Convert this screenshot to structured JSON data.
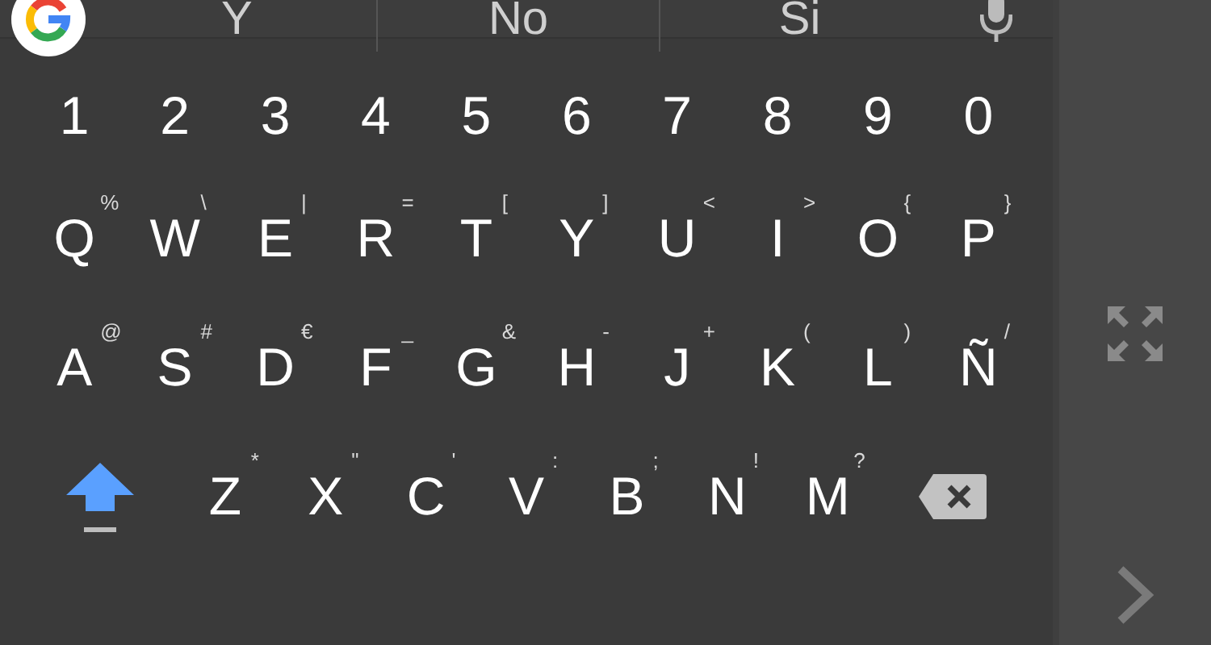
{
  "suggestions": [
    {
      "text": "Y"
    },
    {
      "text": "No"
    },
    {
      "text": "Si"
    }
  ],
  "rows": [
    [
      {
        "kind": "char",
        "label": "1"
      },
      {
        "kind": "char",
        "label": "2"
      },
      {
        "kind": "char",
        "label": "3"
      },
      {
        "kind": "char",
        "label": "4"
      },
      {
        "kind": "char",
        "label": "5"
      },
      {
        "kind": "char",
        "label": "6"
      },
      {
        "kind": "char",
        "label": "7"
      },
      {
        "kind": "char",
        "label": "8"
      },
      {
        "kind": "char",
        "label": "9"
      },
      {
        "kind": "char",
        "label": "0"
      }
    ],
    [
      {
        "kind": "char",
        "label": "Q",
        "hint": "%"
      },
      {
        "kind": "char",
        "label": "W",
        "hint": "\\"
      },
      {
        "kind": "char",
        "label": "E",
        "hint": "|"
      },
      {
        "kind": "char",
        "label": "R",
        "hint": "="
      },
      {
        "kind": "char",
        "label": "T",
        "hint": "["
      },
      {
        "kind": "char",
        "label": "Y",
        "hint": "]"
      },
      {
        "kind": "char",
        "label": "U",
        "hint": "<"
      },
      {
        "kind": "char",
        "label": "I",
        "hint": ">"
      },
      {
        "kind": "char",
        "label": "O",
        "hint": "{"
      },
      {
        "kind": "char",
        "label": "P",
        "hint": "}"
      }
    ],
    [
      {
        "kind": "char",
        "label": "A",
        "hint": "@"
      },
      {
        "kind": "char",
        "label": "S",
        "hint": "#"
      },
      {
        "kind": "char",
        "label": "D",
        "hint": "€"
      },
      {
        "kind": "char",
        "label": "F",
        "hint": "_"
      },
      {
        "kind": "char",
        "label": "G",
        "hint": "&"
      },
      {
        "kind": "char",
        "label": "H",
        "hint": "-"
      },
      {
        "kind": "char",
        "label": "J",
        "hint": "+"
      },
      {
        "kind": "char",
        "label": "K",
        "hint": "("
      },
      {
        "kind": "char",
        "label": "L",
        "hint": ")"
      },
      {
        "kind": "char",
        "label": "Ñ",
        "hint": "/"
      }
    ],
    [
      {
        "kind": "shift",
        "on": true
      },
      {
        "kind": "char",
        "label": "Z",
        "hint": "*"
      },
      {
        "kind": "char",
        "label": "X",
        "hint": "\""
      },
      {
        "kind": "char",
        "label": "C",
        "hint": "'"
      },
      {
        "kind": "char",
        "label": "V",
        "hint": ":"
      },
      {
        "kind": "char",
        "label": "B",
        "hint": ";"
      },
      {
        "kind": "char",
        "label": "N",
        "hint": "!"
      },
      {
        "kind": "char",
        "label": "M",
        "hint": "?"
      },
      {
        "kind": "backspace"
      }
    ]
  ]
}
